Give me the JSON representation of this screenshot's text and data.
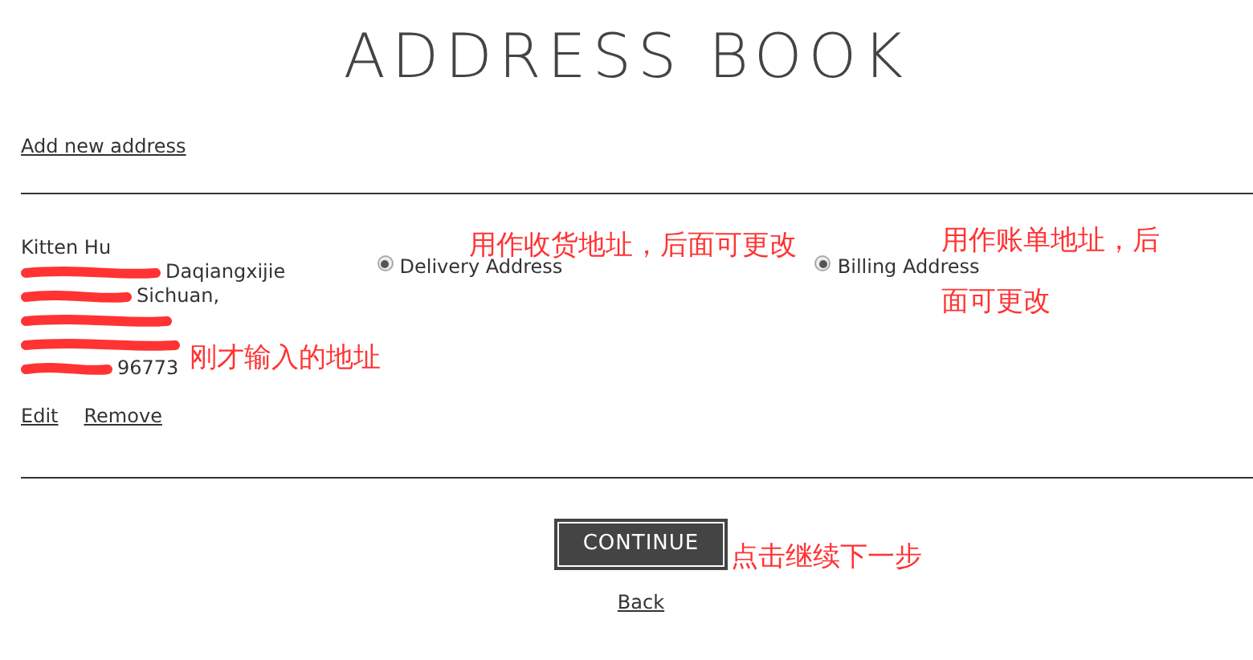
{
  "title": "ADDRESS BOOK",
  "add_link": "Add new address",
  "address": {
    "lines": [
      {
        "kind": "full",
        "text": "Kitten Hu"
      },
      {
        "kind": "tail",
        "text": "Daqiangxijie"
      },
      {
        "kind": "tail",
        "text": "Sichuan,"
      },
      {
        "kind": "hidden"
      },
      {
        "kind": "hidden"
      },
      {
        "kind": "tail",
        "text": "96773"
      }
    ],
    "actions": [
      "Edit",
      "Remove"
    ]
  },
  "options": [
    {
      "label": "Delivery Address",
      "selected": true
    },
    {
      "label": "Billing Address",
      "selected": true
    }
  ],
  "continue": "CONTINUE",
  "back": "Back",
  "annotations": [
    {
      "text": "用作收货地址，后面可更改"
    },
    {
      "text": "用作账单地址，后"
    },
    {
      "text": "面可更改"
    },
    {
      "text": "刚才输入的地址"
    },
    {
      "text": "点击继续下一步"
    }
  ]
}
